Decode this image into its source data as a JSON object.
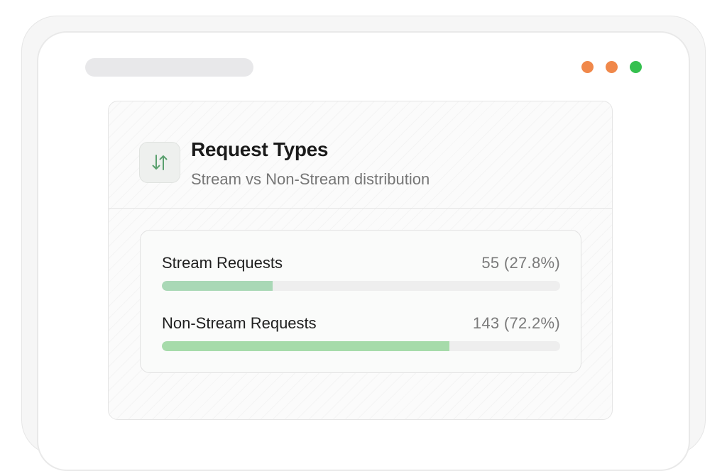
{
  "window": {
    "controls": {
      "dot1_color": "#f0884a",
      "dot2_color": "#f0884a",
      "dot3_color": "#35c04f"
    }
  },
  "card": {
    "icon": "sort-arrows-icon",
    "title": "Request Types",
    "subtitle": "Stream vs Non-Stream distribution"
  },
  "stats": [
    {
      "label": "Stream Requests",
      "value": "55 (27.8%)",
      "fraction": 0.278,
      "color": "#a9d8b6"
    },
    {
      "label": "Non-Stream Requests",
      "value": "143 (72.2%)",
      "fraction": 0.722,
      "color": "#a6dbaa"
    }
  ]
}
